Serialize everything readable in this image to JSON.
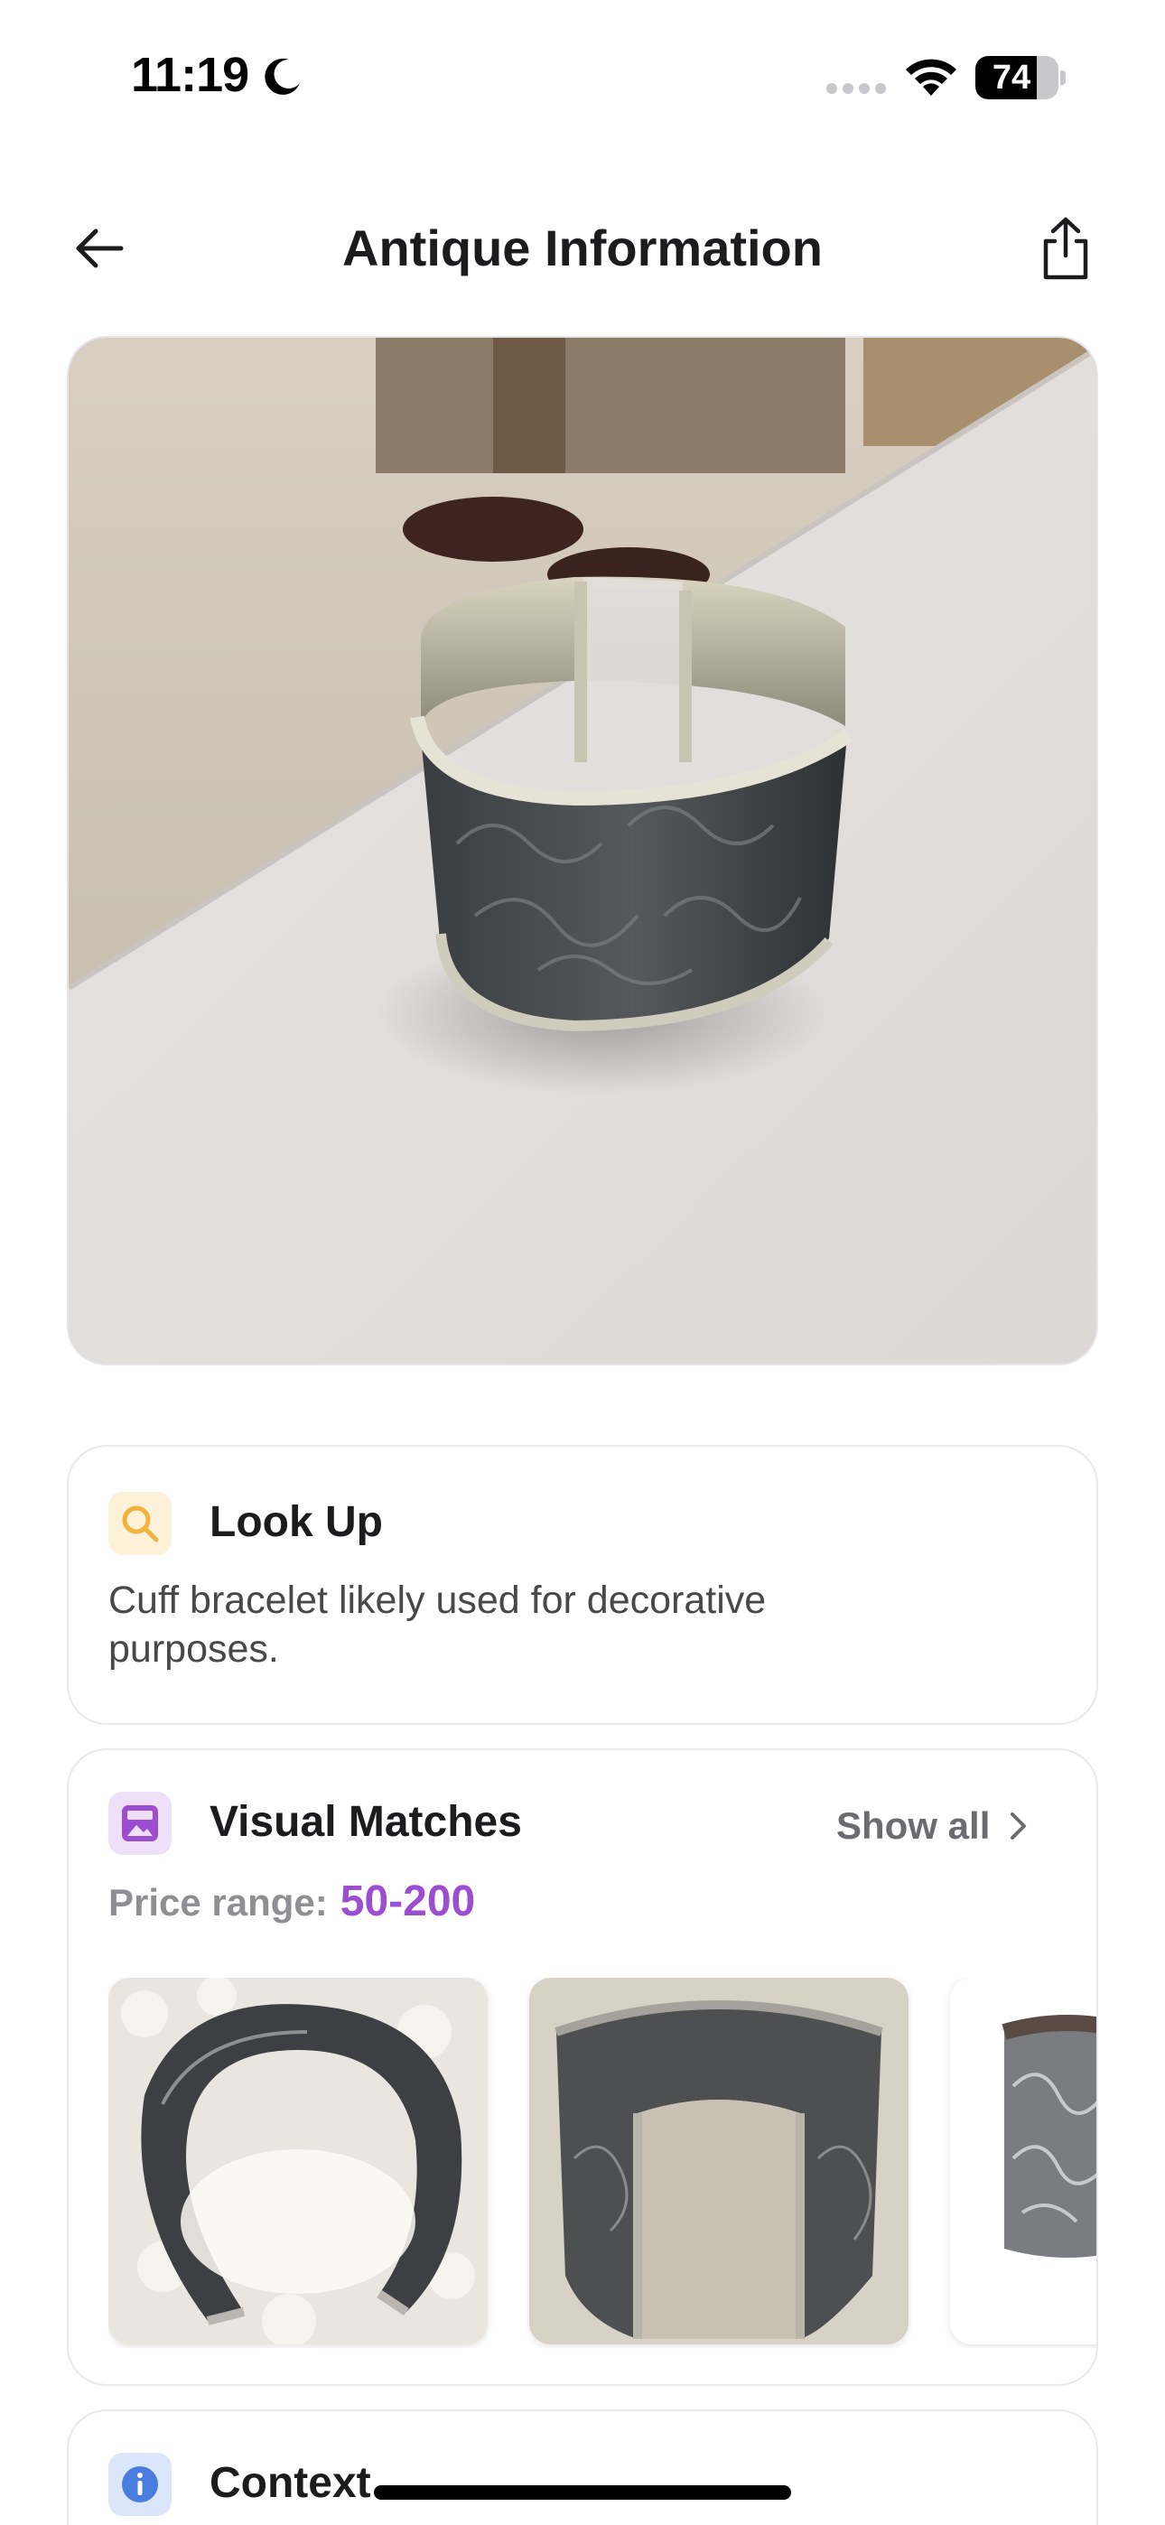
{
  "status_bar": {
    "time": "11:19",
    "battery_level": "74",
    "battery_fraction": 0.74,
    "icons": [
      "moon-icon",
      "cellular-dots-icon",
      "wifi-icon",
      "battery-icon"
    ]
  },
  "nav": {
    "title": "Antique Information",
    "back_icon": "arrow-left-icon",
    "share_icon": "share-icon"
  },
  "hero": {
    "subject": "cuff-bracelet-photo"
  },
  "lookup": {
    "title": "Look Up",
    "description": "Cuff bracelet likely used for decorative purposes.",
    "icon": "search-icon",
    "icon_color": "#f0b43c"
  },
  "visual_matches": {
    "title": "Visual Matches",
    "show_all": "Show all",
    "price_label": "Price range:",
    "price_value": "50-200",
    "price_color": "#9b4fd0",
    "icon": "image-match-icon",
    "thumbnails": [
      "match-thumbnail-1",
      "match-thumbnail-2",
      "match-thumbnail-3"
    ]
  },
  "context": {
    "title": "Context",
    "icon": "info-icon",
    "icon_color": "#4a7de0"
  }
}
